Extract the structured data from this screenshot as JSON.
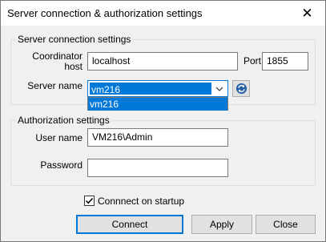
{
  "window": {
    "title": "Server connection & authorization settings",
    "close_glyph": "✕"
  },
  "server_group": {
    "title": "Server connection settings",
    "coordinator_label_line1": "Coordinator",
    "coordinator_label_line2": "host",
    "coordinator_value": "localhost",
    "port_label": "Port",
    "port_value": "1855",
    "server_name_label": "Server name",
    "server_name_value": "vm216",
    "server_name_options": [
      "vm216"
    ],
    "refresh_icon": "refresh-icon"
  },
  "auth_group": {
    "title": "Authorization settings",
    "username_label": "User name",
    "username_value": "VM216\\Admin",
    "password_label": "Password",
    "password_value": ""
  },
  "startup": {
    "label": "Connnect on startup",
    "checked": true
  },
  "buttons": {
    "connect": "Connect",
    "apply": "Apply",
    "close": "Close"
  },
  "colors": {
    "accent": "#0078d7",
    "refresh_icon": "#1f5fa8"
  }
}
